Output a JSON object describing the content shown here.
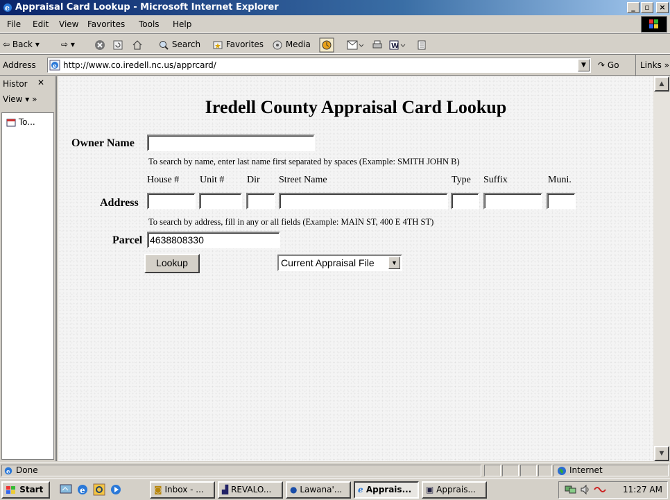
{
  "window": {
    "title": "Appraisal Card Lookup - Microsoft Internet Explorer"
  },
  "menu": [
    "File",
    "Edit",
    "View",
    "Favorites",
    "Tools",
    "Help"
  ],
  "toolbar": {
    "back": "Back",
    "search": "Search",
    "favorites": "Favorites",
    "media": "Media"
  },
  "address": {
    "label": "Address",
    "url": "http://www.co.iredell.nc.us/apprcard/",
    "go": "Go",
    "links": "Links"
  },
  "history": {
    "title": "Histor",
    "view": "View",
    "item": "To..."
  },
  "page": {
    "title": "Iredell County Appraisal Card Lookup",
    "owner_label": "Owner Name",
    "owner_value": "",
    "owner_hint": "To search by name, enter last name first separated by spaces (Example: SMITH JOHN B)",
    "columns": [
      "House #",
      "Unit #",
      "Dir",
      "Street Name",
      "Type",
      "Suffix",
      "Muni."
    ],
    "address_label": "Address",
    "address_hint": "To search by address, fill in any or all fields (Example: MAIN ST, 400 E 4TH ST)",
    "parcel_label": "Parcel",
    "parcel_value": "4638808330",
    "lookup_button": "Lookup",
    "file_select": "Current Appraisal File"
  },
  "status": {
    "text": "Done",
    "zone": "Internet"
  },
  "taskbar": {
    "start": "Start",
    "tasks": [
      "Inbox - ...",
      "REVALO...",
      "Lawana'...",
      "Apprais...",
      "Apprais..."
    ],
    "clock": "11:27 AM"
  }
}
